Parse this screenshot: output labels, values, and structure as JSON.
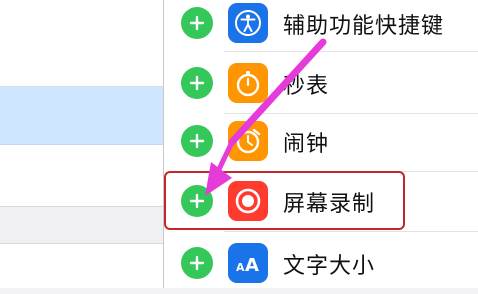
{
  "list": {
    "items": [
      {
        "label": "辅助功能快捷键",
        "icon": "accessibility-icon",
        "icon_color": "#1a73e8"
      },
      {
        "label": "秒表",
        "icon": "stopwatch-icon",
        "icon_color": "#ff9500"
      },
      {
        "label": "闹钟",
        "icon": "alarm-clock-icon",
        "icon_color": "#ff9500"
      },
      {
        "label": "屏幕录制",
        "icon": "screen-record-icon",
        "icon_color": "#ff3b30"
      },
      {
        "label": "文字大小",
        "icon": "text-size-icon",
        "icon_color": "#1a73e8"
      }
    ],
    "add_icon": "plus-icon",
    "add_color": "#34c759"
  },
  "annotation": {
    "highlighted_item": "屏幕录制",
    "highlight_color": "#c0282a",
    "arrow_color": "#e53bd8"
  },
  "left_panel": {
    "selected_color": "#cfe6ff"
  }
}
